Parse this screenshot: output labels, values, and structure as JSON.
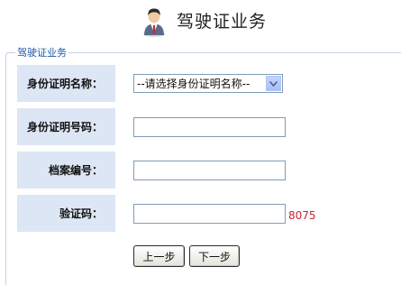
{
  "header": {
    "title": "驾驶证业务",
    "icon": "user-avatar-icon"
  },
  "section": {
    "legend": "驾驶证业务"
  },
  "form": {
    "id_type": {
      "label": "身份证明名称：",
      "selected": "--请选择身份证明名称--"
    },
    "id_number": {
      "label": "身份证明号码：",
      "value": ""
    },
    "file_number": {
      "label": "档案编号：",
      "value": ""
    },
    "captcha": {
      "label": "验证码：",
      "value": "",
      "code": "8075"
    }
  },
  "buttons": {
    "prev": "上一步",
    "next": "下一步"
  },
  "colors": {
    "label_bg": "#dde6f5",
    "legend_text": "#1f55a8",
    "captcha_text": "#cc2233",
    "border": "#7f9db9"
  }
}
